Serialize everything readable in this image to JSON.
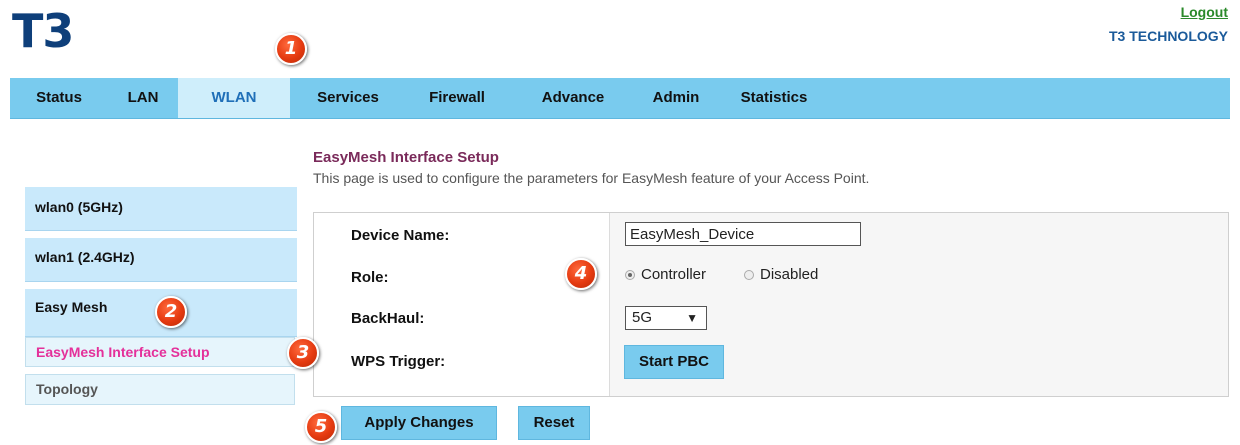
{
  "brand": {
    "logo": "T3",
    "company": "T3 TECHNOLOGY",
    "logout": "Logout"
  },
  "nav": {
    "items": [
      {
        "label": "Status"
      },
      {
        "label": "LAN"
      },
      {
        "label": "WLAN",
        "active": true
      },
      {
        "label": "Services"
      },
      {
        "label": "Firewall"
      },
      {
        "label": "Advance"
      },
      {
        "label": "Admin"
      },
      {
        "label": "Statistics"
      }
    ]
  },
  "sidebar": {
    "items": [
      {
        "label": "wlan0 (5GHz)"
      },
      {
        "label": "wlan1 (2.4GHz)"
      },
      {
        "label": "Easy Mesh"
      }
    ],
    "subitems": [
      {
        "label": "EasyMesh Interface Setup",
        "active": true
      },
      {
        "label": "Topology"
      }
    ]
  },
  "main": {
    "title": "EasyMesh Interface Setup",
    "description": "This page is used to configure the parameters for EasyMesh feature of your Access Point.",
    "fields": {
      "device_name_label": "Device Name:",
      "device_name_value": "EasyMesh_Device",
      "role_label": "Role:",
      "role_options": [
        "Controller",
        "Disabled"
      ],
      "role_selected": "Controller",
      "backhaul_label": "BackHaul:",
      "backhaul_value": "5G",
      "wps_label": "WPS Trigger:",
      "wps_button": "Start PBC"
    },
    "actions": {
      "apply": "Apply Changes",
      "reset": "Reset"
    }
  },
  "badges": [
    "1",
    "2",
    "3",
    "4",
    "5"
  ],
  "colors": {
    "nav_bg": "#79cbee",
    "nav_active_bg": "#cfeefb",
    "nav_active_text": "#1f6fb8",
    "sidebar_bg": "#c9e9fb",
    "submenu_active_text": "#e4309a",
    "title_color": "#7a2a5a",
    "badge_red": "#e53a10",
    "logo_color": "#0e3f7a"
  }
}
